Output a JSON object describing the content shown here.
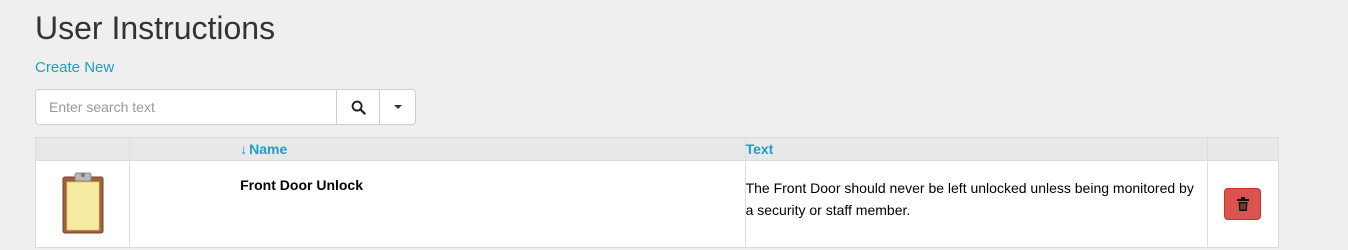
{
  "page": {
    "title": "User Instructions",
    "create_link": "Create New"
  },
  "search": {
    "placeholder": "Enter search text",
    "search_icon": "search-icon",
    "dropdown_icon": "caret-down-icon"
  },
  "table": {
    "columns": [
      {
        "label": ""
      },
      {
        "label": "Name",
        "sort": "descending",
        "sort_icon": "sort-down-arrow-icon"
      },
      {
        "label": "Text"
      },
      {
        "label": ""
      }
    ],
    "rows": [
      {
        "icon": "clipboard-icon",
        "name": "Front Door Unlock",
        "text": "The Front Door should never be left unlocked unless being monitored by a security or staff member.",
        "action_icon": "trash-icon"
      }
    ]
  },
  "colors": {
    "link": "#1aa0c4",
    "danger": "#d9534f",
    "background": "#efefef"
  }
}
